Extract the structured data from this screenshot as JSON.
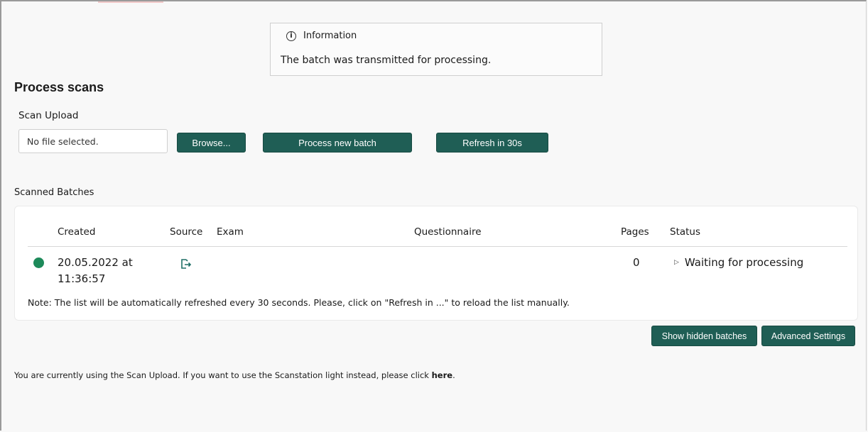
{
  "info": {
    "title": "Information",
    "message": "The batch was transmitted for processing."
  },
  "page": {
    "title": "Process scans"
  },
  "upload": {
    "label": "Scan Upload",
    "file_placeholder": "No file selected.",
    "browse_label": "Browse...",
    "process_label": "Process new batch",
    "refresh_label": "Refresh in 30s"
  },
  "batches": {
    "label": "Scanned Batches",
    "columns": {
      "created": "Created",
      "source": "Source",
      "exam": "Exam",
      "questionnaire": "Questionnaire",
      "pages": "Pages",
      "status": "Status"
    },
    "rows": [
      {
        "created_date": "20.05.2022 at",
        "created_time": "11:36:57",
        "source_icon": "upload-export-icon",
        "exam": "",
        "questionnaire": "",
        "pages": "0",
        "status": "Waiting for processing",
        "status_color": "#1d8a5a"
      }
    ],
    "note": "Note: The list will be automatically refreshed every 30 seconds. Please, click on \"Refresh in ...\" to reload the list manually."
  },
  "actions": {
    "show_hidden": "Show hidden batches",
    "advanced_settings": "Advanced Settings"
  },
  "footer": {
    "text": "You are currently using the Scan Upload. If you want to use the Scanstation light instead, please click ",
    "link": "here",
    "end": "."
  },
  "colors": {
    "accent": "#1f5e55",
    "status_ok": "#1d8a5a"
  }
}
